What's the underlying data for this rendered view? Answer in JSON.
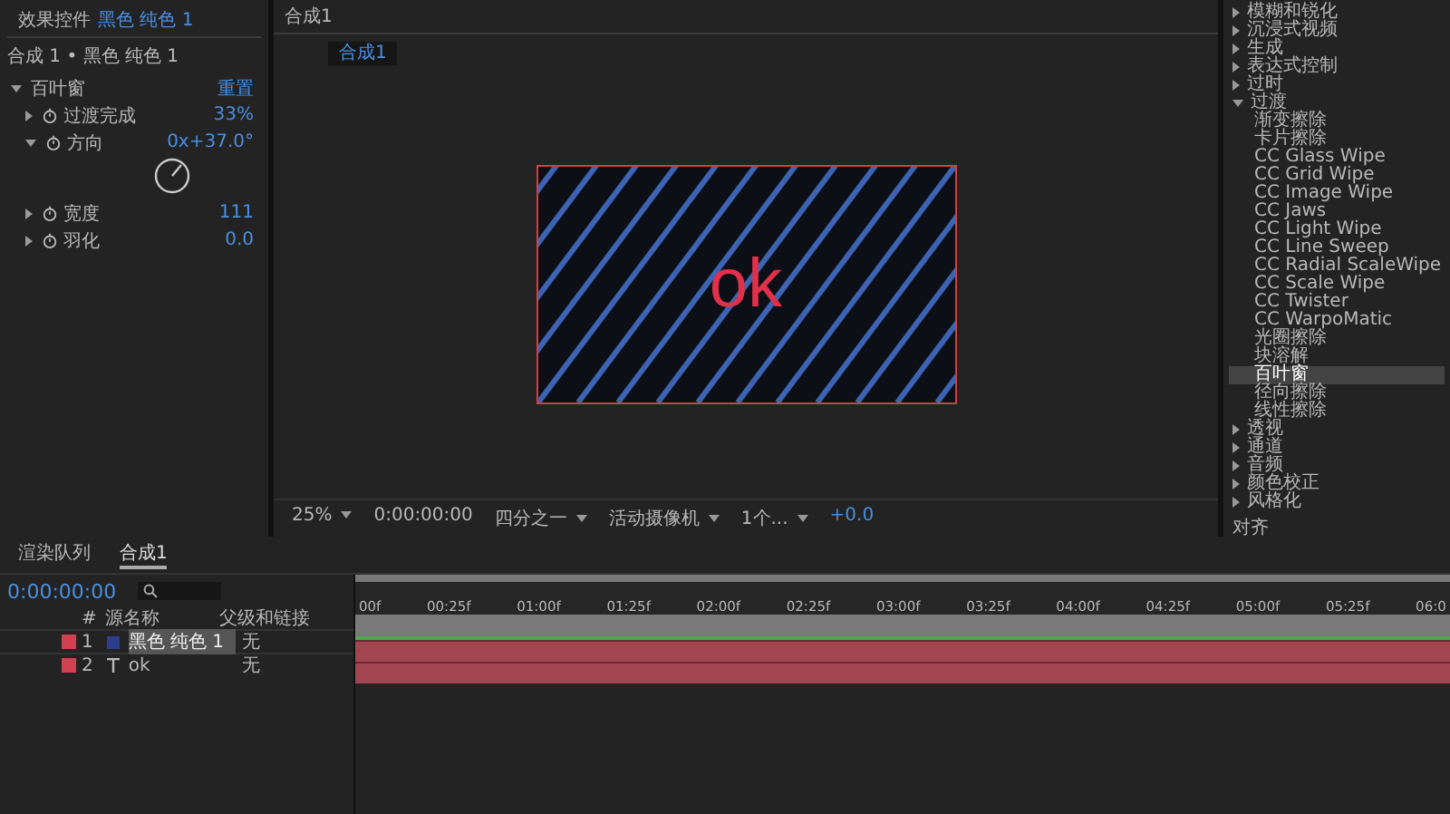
{
  "effect_controls": {
    "tab_label": "效果控件",
    "tab_layer": "黑色 纯色 1",
    "breadcrumb": "合成 1 • 黑色 纯色 1",
    "effect": {
      "name": "百叶窗",
      "reset": "重置",
      "expanded": true,
      "params": [
        {
          "kind": "value",
          "name": "过渡完成",
          "value": "33%",
          "expanded": false
        },
        {
          "kind": "angle",
          "name": "方向",
          "value": "0x+37.0°",
          "expanded": true
        },
        {
          "kind": "value",
          "name": "宽度",
          "value": "111",
          "expanded": false
        },
        {
          "kind": "value",
          "name": "羽化",
          "value": "0.0",
          "expanded": false
        }
      ]
    }
  },
  "viewer": {
    "tab": "合成1",
    "sub_tab": "合成1",
    "canvas_text": "ok",
    "zoom": "25%",
    "time": "0:00:00:00",
    "resolution": "四分之一",
    "camera": "活动摄像机",
    "views": "1个...",
    "exposure": "+0.0"
  },
  "effects_panel": {
    "categories": [
      {
        "label": "模糊和锐化",
        "expanded": false
      },
      {
        "label": "沉浸式视频",
        "expanded": false
      },
      {
        "label": "生成",
        "expanded": false
      },
      {
        "label": "表达式控制",
        "expanded": false
      },
      {
        "label": "过时",
        "expanded": false
      },
      {
        "label": "过渡",
        "expanded": true,
        "children": [
          {
            "label": "渐变擦除",
            "selected": false
          },
          {
            "label": "卡片擦除",
            "selected": false
          },
          {
            "label": "CC Glass Wipe",
            "selected": false
          },
          {
            "label": "CC Grid Wipe",
            "selected": false
          },
          {
            "label": "CC Image Wipe",
            "selected": false
          },
          {
            "label": "CC Jaws",
            "selected": false
          },
          {
            "label": "CC Light Wipe",
            "selected": false
          },
          {
            "label": "CC Line Sweep",
            "selected": false
          },
          {
            "label": "CC Radial ScaleWipe",
            "selected": false
          },
          {
            "label": "CC Scale Wipe",
            "selected": false
          },
          {
            "label": "CC Twister",
            "selected": false
          },
          {
            "label": "CC WarpoMatic",
            "selected": false
          },
          {
            "label": "光圈擦除",
            "selected": false
          },
          {
            "label": "块溶解",
            "selected": false
          },
          {
            "label": "百叶窗",
            "selected": true
          },
          {
            "label": "径向擦除",
            "selected": false
          },
          {
            "label": "线性擦除",
            "selected": false
          }
        ]
      },
      {
        "label": "透视",
        "expanded": false
      },
      {
        "label": "通道",
        "expanded": false
      },
      {
        "label": "音频",
        "expanded": false
      },
      {
        "label": "颜色校正",
        "expanded": false
      },
      {
        "label": "风格化",
        "expanded": false
      }
    ],
    "footer": "对齐"
  },
  "timeline": {
    "tabs": [
      {
        "label": "渲染队列",
        "selected": false
      },
      {
        "label": "合成1",
        "selected": true
      }
    ],
    "time": "0:00:00:00",
    "columns": [
      "#",
      "源名称",
      "父级和链接"
    ],
    "layers": [
      {
        "index": "1",
        "kind": "solid",
        "name": "黑色 纯色 1",
        "parent": "无",
        "selected": true
      },
      {
        "index": "2",
        "kind": "text",
        "name": "ok",
        "parent": "无",
        "selected": false
      }
    ],
    "ticks": [
      "00f",
      "00:25f",
      "01:00f",
      "01:25f",
      "02:00f",
      "02:25f",
      "03:00f",
      "03:25f",
      "04:00f",
      "04:25f",
      "05:00f",
      "05:25f",
      "06:0"
    ]
  }
}
